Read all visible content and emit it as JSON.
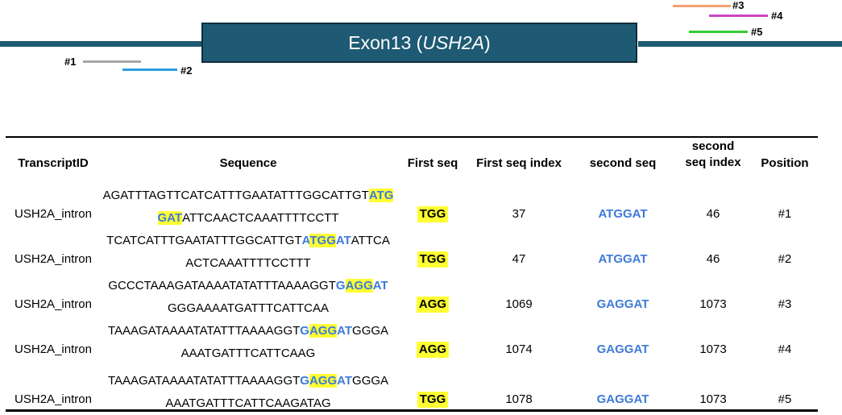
{
  "diagram": {
    "exon_label_prefix": "Exon13 (",
    "exon_gene": "USH2A",
    "exon_label_suffix": ")",
    "guides": [
      {
        "label": "#1",
        "color": "#a6a6a6"
      },
      {
        "label": "#2",
        "color": "#2a9fe0"
      },
      {
        "label": "#3",
        "color": "#f4a070"
      },
      {
        "label": "#4",
        "color": "#cc44c4"
      },
      {
        "label": "#5",
        "color": "#33cc33"
      }
    ]
  },
  "table": {
    "headers": {
      "transcript": "TranscriptID",
      "sequence": "Sequence",
      "first_seq": "First seq",
      "first_idx": "First seq index",
      "second_seq": "second seq",
      "second_idx_l1": "second",
      "second_idx_l2": "seq index",
      "position": "Position"
    },
    "rows": [
      {
        "transcript": "USH2A_intron",
        "seq_line1": [
          {
            "t": "AGATTTAGTTCATCATTTGAATATTTGGCATTGT",
            "s": ""
          },
          {
            "t": "ATG",
            "s": "blue hl"
          }
        ],
        "seq_line2": [
          {
            "t": "GAT",
            "s": "blue hl"
          },
          {
            "t": "ATTCAACTCAAATTTTCCTT",
            "s": ""
          }
        ],
        "first": "TGG",
        "first_idx": "37",
        "second": "ATGGAT",
        "second_idx": "46",
        "position": "#1"
      },
      {
        "transcript": "USH2A_intron",
        "seq_line1": [
          {
            "t": "TCATCATTTGAATATTTGGCATTGT",
            "s": ""
          },
          {
            "t": "A",
            "s": "blue"
          },
          {
            "t": "TGG",
            "s": "blue hl"
          },
          {
            "t": "AT",
            "s": "blue"
          },
          {
            "t": "ATTCA",
            "s": ""
          }
        ],
        "seq_line2": [
          {
            "t": "ACTCAAATTTTCCTTT",
            "s": ""
          }
        ],
        "first": "TGG",
        "first_idx": "47",
        "second": "ATGGAT",
        "second_idx": "46",
        "position": "#2"
      },
      {
        "transcript": "USH2A_intron",
        "seq_line1": [
          {
            "t": "GCCCTAAAGATAAAATATATTTAAAAGGT",
            "s": ""
          },
          {
            "t": "G",
            "s": "blue"
          },
          {
            "t": "AGG",
            "s": "blue hl"
          },
          {
            "t": "AT",
            "s": "blue"
          }
        ],
        "seq_line2": [
          {
            "t": "GGGAAAATGATTTCATTCAA",
            "s": ""
          }
        ],
        "first": "AGG",
        "first_idx": "1069",
        "second": "GAGGAT",
        "second_idx": "1073",
        "position": "#3"
      },
      {
        "transcript": "USH2A_intron",
        "seq_line1": [
          {
            "t": "TAAAGATAAAATATATTTAAAAGGT",
            "s": ""
          },
          {
            "t": "G",
            "s": "blue"
          },
          {
            "t": "AGG",
            "s": "blue hl"
          },
          {
            "t": "AT",
            "s": "blue"
          },
          {
            "t": "GGGA",
            "s": ""
          }
        ],
        "seq_line2": [
          {
            "t": "AAATGATTTCATTCAAG",
            "s": ""
          }
        ],
        "first": "AGG",
        "first_idx": "1074",
        "second": "GAGGAT",
        "second_idx": "1073",
        "position": "#4"
      },
      {
        "transcript": "USH2A_intron",
        "seq_line1": [
          {
            "t": "TAAAGATAAAATATATTTAAAAGGT",
            "s": ""
          },
          {
            "t": "G",
            "s": "blue"
          },
          {
            "t": "AGG",
            "s": "blue hl"
          },
          {
            "t": "AT",
            "s": "blue"
          },
          {
            "t": "GGGA",
            "s": ""
          }
        ],
        "seq_line2": [
          {
            "t": "AAATGATTTCATTCAAGATAG",
            "s": ""
          }
        ],
        "first": "TGG",
        "first_idx": "1078",
        "second": "GAGGAT",
        "second_idx": "1073",
        "position": "#5"
      }
    ]
  }
}
